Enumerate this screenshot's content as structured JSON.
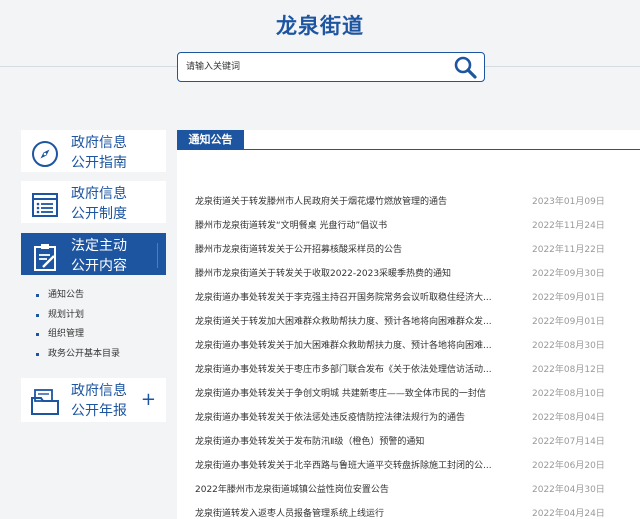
{
  "site": {
    "title": "龙泉街道",
    "search_placeholder": "请输入关键词",
    "search_icon": "search-icon"
  },
  "sidebar": {
    "cards": [
      {
        "label_line1": "政府信息",
        "label_line2": "公开指南",
        "icon": "compass-icon"
      },
      {
        "label_line1": "政府信息",
        "label_line2": "公开制度",
        "icon": "list-icon"
      },
      {
        "label_line1": "法定主动",
        "label_line2": "公开内容",
        "icon": "clipboard-edit-icon"
      },
      {
        "label_line1": "政府信息",
        "label_line2": "公开年报",
        "icon": "folder-icon",
        "expand": "+"
      }
    ],
    "sub_items": [
      "通知公告",
      "规划计划",
      "组织管理",
      "政务公开基本目录"
    ]
  },
  "panel": {
    "tab_label": "通知公告",
    "news": [
      {
        "title": "龙泉街道关于转发滕州市人民政府关于烟花爆竹燃放管理的通告",
        "date": "2023年01月09日"
      },
      {
        "title": "滕州市龙泉街道转发“文明餐桌 光盘行动”倡议书",
        "date": "2022年11月24日"
      },
      {
        "title": "滕州市龙泉街道转发关于公开招募核酸采样员的公告",
        "date": "2022年11月22日"
      },
      {
        "title": "滕州市龙泉街道关于转发关于收取2022-2023采暖季热费的通知",
        "date": "2022年09月30日"
      },
      {
        "title": "龙泉街道办事处转发关于李克强主持召开国务院常务会议听取稳住经济大...",
        "date": "2022年09月01日"
      },
      {
        "title": "龙泉街道关于转发加大困难群众救助帮扶力度、预计各地将向困难群众发...",
        "date": "2022年09月01日"
      },
      {
        "title": "龙泉街道办事处转发关于加大困难群众救助帮扶力度、预计各地将向困难...",
        "date": "2022年08月30日"
      },
      {
        "title": "龙泉街道办事处转发关于枣庄市多部门联合发布《关于依法处理信访活动...",
        "date": "2022年08月12日"
      },
      {
        "title": "龙泉街道办事处转发关于争创文明城 共建新枣庄——致全体市民的一封信",
        "date": "2022年08月10日"
      },
      {
        "title": "龙泉街道办事处转发关于依法惩处违反疫情防控法律法规行为的通告",
        "date": "2022年08月04日"
      },
      {
        "title": "龙泉街道办事处转发关于发布防汛Ⅱ级（橙色）预警的通知",
        "date": "2022年07月14日"
      },
      {
        "title": "龙泉街道办事处转发关于北辛西路与鲁班大道平交转盘拆除施工封闭的公...",
        "date": "2022年06月20日"
      },
      {
        "title": "2022年滕州市龙泉街道城镇公益性岗位安置公告",
        "date": "2022年04月30日"
      },
      {
        "title": "龙泉街道转发入返枣人员报备管理系统上线运行",
        "date": "2022年04月24日"
      }
    ]
  },
  "colors": {
    "accent": "#1d55a1",
    "background": "#f3f4f6",
    "date": "#999999"
  }
}
